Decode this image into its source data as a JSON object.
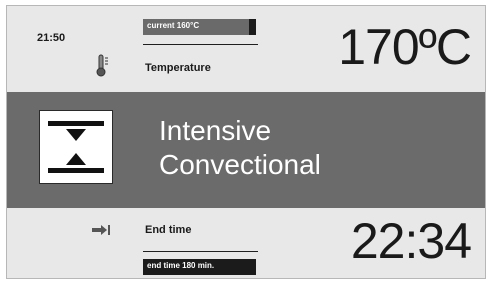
{
  "status": {
    "clock": "21:50"
  },
  "temperature": {
    "current_label": "current 160°C",
    "current_fraction": 0.94,
    "label": "Temperature",
    "setpoint": "170ºC",
    "icon": "thermometer-icon"
  },
  "mode": {
    "line1": "Intensive",
    "line2": "Convectional",
    "icon": "intensive-convection-icon"
  },
  "end_time": {
    "label": "End time",
    "value": "22:34",
    "duration_label": "end time 180 min.",
    "icon": "arrow-to-bar-icon"
  },
  "colors": {
    "band": "#6b6b6b",
    "background": "#e8e8e8",
    "text": "#1a1a1a"
  }
}
